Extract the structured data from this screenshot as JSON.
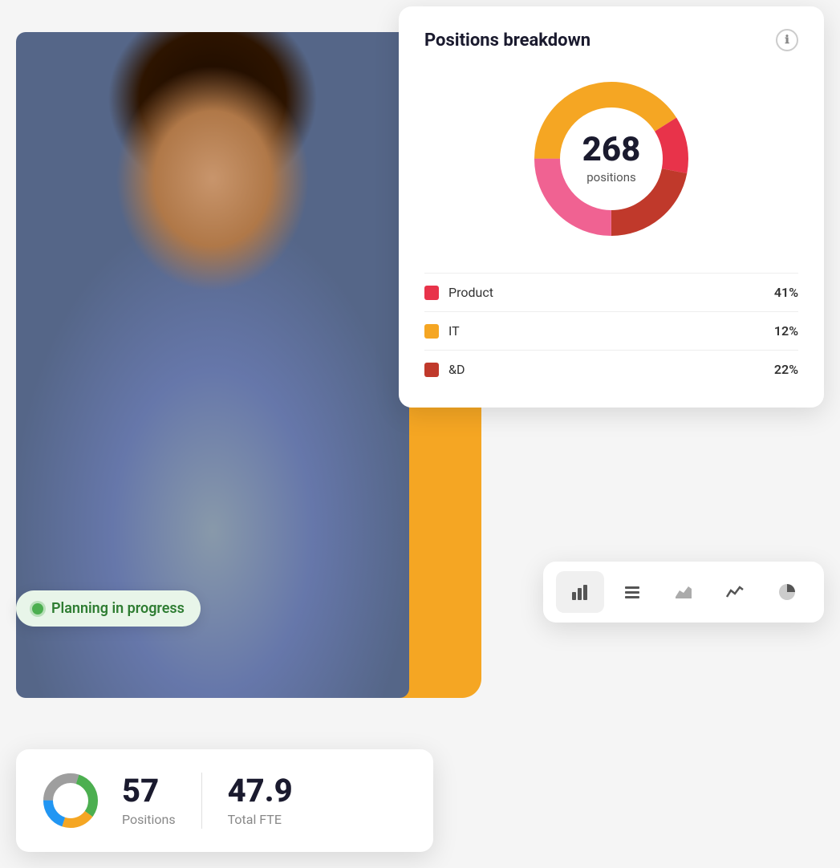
{
  "positions_card": {
    "title": "Positions breakdown",
    "info_icon": "ℹ",
    "total_number": "268",
    "total_label": "positions",
    "chart": {
      "segments": [
        {
          "color": "#F5A623",
          "percent": 41,
          "start": 0
        },
        {
          "color": "#E8334A",
          "percent": 12,
          "start": 41
        },
        {
          "color": "#C0392B",
          "percent": 22,
          "start": 53
        },
        {
          "color": "#F06292",
          "percent": 25,
          "start": 75
        }
      ]
    },
    "legend": [
      {
        "name": "Product",
        "color": "#E8334A",
        "pct": "41%"
      },
      {
        "name": "IT",
        "color": "#F5A623",
        "pct": "12%"
      },
      {
        "name": "&D",
        "color": "#C0392B",
        "pct": "22%"
      }
    ]
  },
  "toolbar": {
    "buttons": [
      {
        "icon": "📊",
        "label": "bar-chart",
        "active": true
      },
      {
        "icon": "≡",
        "label": "list"
      },
      {
        "icon": "📈",
        "label": "area-chart"
      },
      {
        "icon": "〜",
        "label": "line-chart"
      },
      {
        "icon": "◑",
        "label": "pie-chart"
      }
    ]
  },
  "planning_badge": {
    "text": "Planning in progress"
  },
  "stats_card": {
    "positions_number": "57",
    "positions_label": "Positions",
    "fte_number": "47.9",
    "fte_label": "Total FTE"
  }
}
